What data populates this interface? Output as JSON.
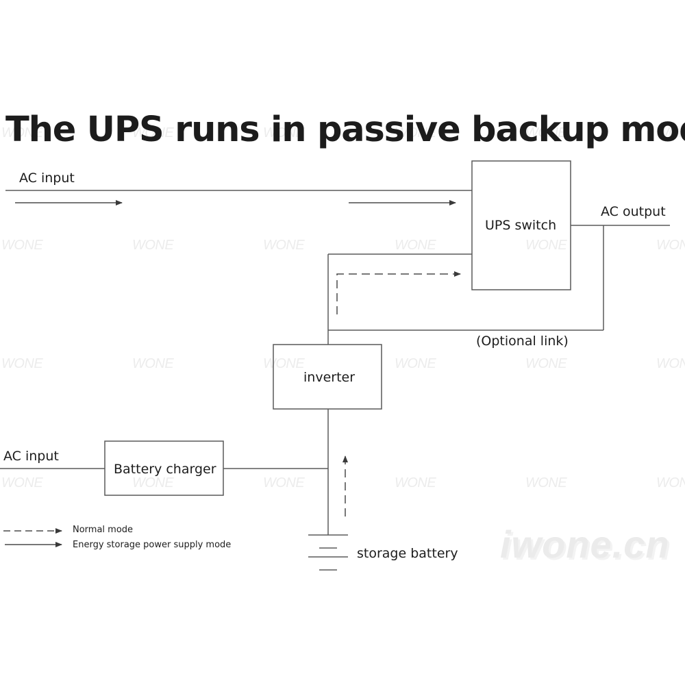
{
  "title": "The UPS runs in passive backup mode",
  "watermark": {
    "text": "WONE",
    "site": "iwone.cn"
  },
  "blocks": {
    "ups_switch": "UPS switch",
    "inverter": "inverter",
    "battery_charger": "Battery charger",
    "storage_battery": "storage battery"
  },
  "labels": {
    "ac_input_top": "AC input",
    "ac_input_bottom": "AC input",
    "ac_output": "AC output",
    "optional_link": "(Optional link)"
  },
  "legend": {
    "items": [
      {
        "style": "dashed",
        "label": "Normal mode"
      },
      {
        "style": "solid",
        "label": "Energy storage power supply mode"
      }
    ]
  }
}
